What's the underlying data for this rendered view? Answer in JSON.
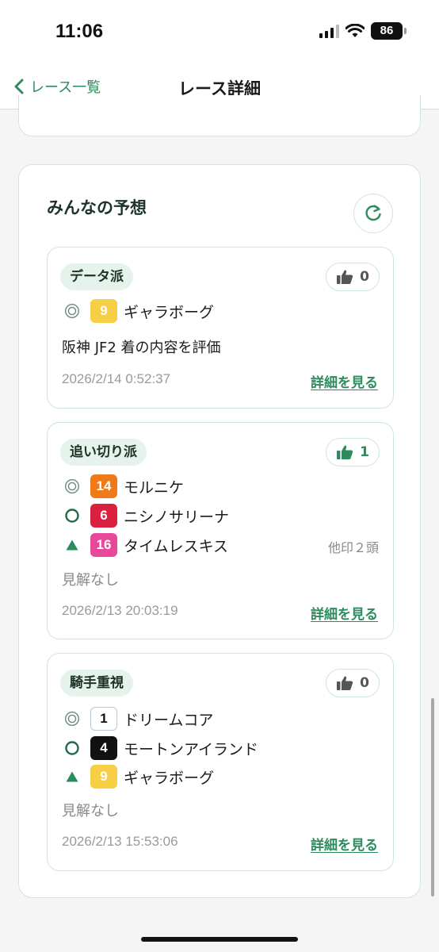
{
  "status": {
    "time": "11:06",
    "battery": "86"
  },
  "nav": {
    "back_label": "レース一覧",
    "title": "レース詳細"
  },
  "section": {
    "title": "みんなの予想"
  },
  "colors": {
    "accent": "#2e8b5e",
    "border": "#cfe6da",
    "tag_bg": "#e6f3ec"
  },
  "predictions": [
    {
      "style": "データ派",
      "likes": "0",
      "horses": [
        {
          "mark": "double-circle",
          "number": "9",
          "badge_color": "#f7cf45",
          "badge_text_color": "#ffffff",
          "name": "ギャラボーグ"
        }
      ],
      "other_marks": "",
      "comment": "阪神 JF2 着の内容を評価",
      "timestamp": "2026/2/14 0:52:37",
      "detail_label": "詳細を見る"
    },
    {
      "style": "追い切り派",
      "likes": "1",
      "horses": [
        {
          "mark": "double-circle",
          "number": "14",
          "badge_color": "#f07a1a",
          "badge_text_color": "#ffffff",
          "name": "モルニケ"
        },
        {
          "mark": "circle",
          "number": "6",
          "badge_color": "#d9213f",
          "badge_text_color": "#ffffff",
          "name": "ニシノサリーナ"
        },
        {
          "mark": "triangle",
          "number": "16",
          "badge_color": "#e8489a",
          "badge_text_color": "#ffffff",
          "name": "タイムレスキス"
        }
      ],
      "other_marks": "他印２頭",
      "comment": "見解なし",
      "timestamp": "2026/2/13 20:03:19",
      "detail_label": "詳細を見る"
    },
    {
      "style": "騎手重視",
      "likes": "0",
      "horses": [
        {
          "mark": "double-circle",
          "number": "1",
          "badge_color": "#ffffff",
          "badge_text_color": "#111111",
          "name": "ドリームコア"
        },
        {
          "mark": "circle",
          "number": "4",
          "badge_color": "#111111",
          "badge_text_color": "#ffffff",
          "name": "モートンアイランド"
        },
        {
          "mark": "triangle",
          "number": "9",
          "badge_color": "#f7cf45",
          "badge_text_color": "#ffffff",
          "name": "ギャラボーグ"
        }
      ],
      "other_marks": "",
      "comment": "見解なし",
      "timestamp": "2026/2/13 15:53:06",
      "detail_label": "詳細を見る"
    }
  ]
}
